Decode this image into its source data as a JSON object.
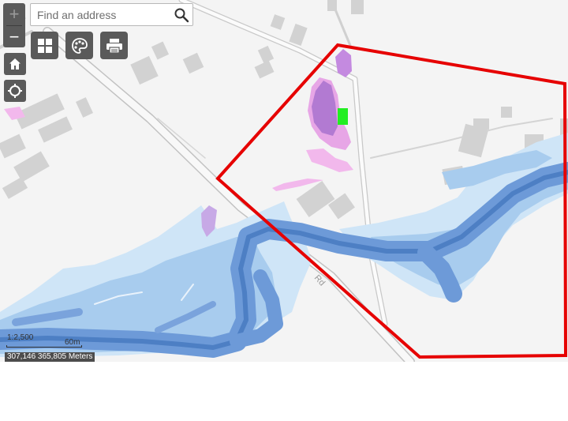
{
  "search": {
    "placeholder": "Find an address"
  },
  "controls": {
    "zoom_in": "+",
    "zoom_out": "−",
    "home_icon": "home-icon",
    "locate_icon": "crosshair-locate-icon",
    "basemap_icon": "grid-basemap-icon",
    "layers_icon": "palette-layers-icon",
    "print_icon": "printer-icon"
  },
  "map": {
    "road_label": "Rd",
    "scale_ratio": "1:2,500",
    "scale_distance": "60m",
    "coordinates": "307,146 365,805 Meters"
  },
  "colors": {
    "background": "#f4f4f4",
    "road_outline": "#c8c8c8",
    "building": "#cfcfcf",
    "flood_light": "#cde4f7",
    "flood_medium": "#a9cdee",
    "river": "#6e9bd8",
    "river_channel": "#5082c6",
    "pink_zone": "#f2b6e8",
    "purple_zone": "#b27bd0",
    "site_marker": "#22ee22",
    "boundary": "#e60000"
  }
}
